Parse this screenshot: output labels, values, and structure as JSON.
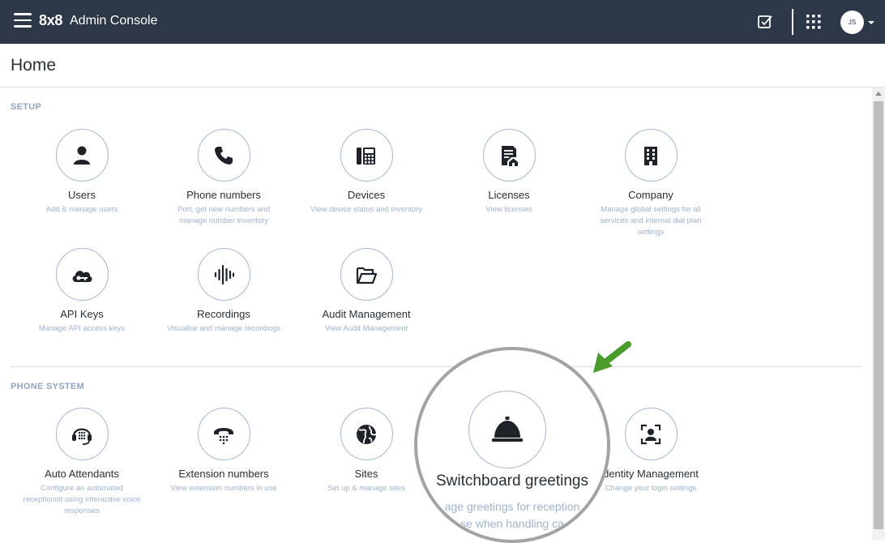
{
  "topbar": {
    "brand": "8x8",
    "app_title": "Admin Console",
    "avatar_initials": "JS",
    "icons": [
      "menu-icon",
      "tasks-check-icon",
      "app-grid-icon",
      "chevron-down-icon"
    ]
  },
  "page": {
    "title": "Home"
  },
  "sections": {
    "setup": {
      "title": "SETUP",
      "tiles": [
        {
          "name": "Users",
          "desc": "Add & manage users",
          "icon": "user-icon"
        },
        {
          "name": "Phone numbers",
          "desc": "Port, get new numbers and manage number inventory",
          "icon": "phone-icon"
        },
        {
          "name": "Devices",
          "desc": "View device status and inventory",
          "icon": "desk-phone-icon"
        },
        {
          "name": "Licenses",
          "desc": "View licenses",
          "icon": "license-icon"
        },
        {
          "name": "Company",
          "desc": "Manage global settings for all services and internal dial plan settings",
          "icon": "building-icon"
        },
        {
          "name": "API Keys",
          "desc": "Manage API access keys",
          "icon": "cloud-key-icon"
        },
        {
          "name": "Recordings",
          "desc": "Visualise and manage recordings",
          "icon": "audio-wave-icon"
        },
        {
          "name": "Audit Management",
          "desc": "View Audit Management",
          "icon": "folder-open-icon"
        }
      ]
    },
    "phone_system": {
      "title": "PHONE SYSTEM",
      "tiles": [
        {
          "name": "Auto Attendants",
          "desc": "Configure an automated receptionist using interactive voice responses",
          "icon": "headset-icon"
        },
        {
          "name": "Extension numbers",
          "desc": "View extension numbers in use",
          "icon": "phone-keypad-icon"
        },
        {
          "name": "Sites",
          "desc": "Set up & manage sites",
          "icon": "globe-icon"
        },
        {
          "name": "dentity Management",
          "desc": "Change your login settings",
          "icon": "identity-icon"
        }
      ]
    }
  },
  "zoom": {
    "name": "Switchboard greetings",
    "desc_line1": "age greetings for reception",
    "desc_line2": "se when handling ca",
    "icon": "service-bell-icon"
  },
  "annotation": {
    "arrow_color": "#4a9c2a",
    "icon": "arrow-pointer-icon"
  },
  "colors": {
    "topbar": "#2c3748",
    "accent_text": "#93a6c0",
    "desc_text": "#9fb3cc"
  }
}
